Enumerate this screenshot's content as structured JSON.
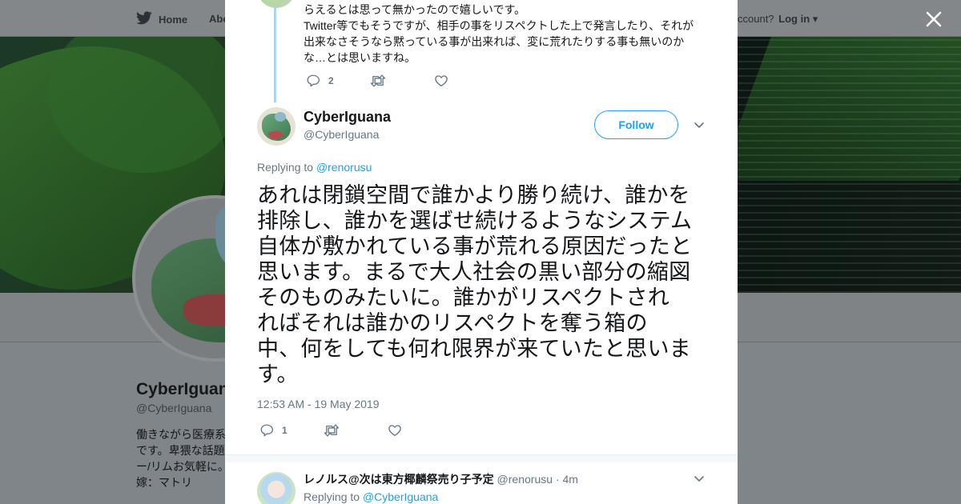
{
  "nav": {
    "home_label": "Home",
    "about_label": "Abo",
    "account_prompt": "ccount?",
    "login_label": "Log in"
  },
  "background_profile": {
    "name": "CyberIguana",
    "handle": "@CyberIguana",
    "bio_lines": [
      "働きながら医療系",
      "です。卑猥な話題",
      "ー/リムお気軽に。",
      "嫁：マトリ"
    ]
  },
  "previous_tweet": {
    "text_lines": [
      "らえるとは思って無かったので嬉しいです。",
      "Twitter等でもそうですが、相手の事をリスペクトした上で発言したり、それが",
      "出来なさそうなら黙っている事が出来れば、変に荒れたりする事も無いのか",
      "な…とは思いますね。"
    ],
    "reply_count": "2",
    "retweet_count": "",
    "like_count": ""
  },
  "main_tweet": {
    "name": "CyberIguana",
    "handle": "@CyberIguana",
    "follow_label": "Follow",
    "replying_prefix": "Replying to",
    "replying_to": "@renorusu",
    "text_lines": [
      "あれは閉鎖空間で誰かより勝り続け、誰かを",
      "排除し、誰かを選ばせ続けるようなシステム",
      "自体が敷かれている事が荒れる原因だったと",
      "思います。まるで大人社会の黒い部分の縮図",
      "そのものみたいに。誰かがリスペクトされ",
      "ればそれは誰かのリスペクトを奪う箱の",
      "中、何をしても何れ限界が来ていたと思いま",
      "す。"
    ],
    "timestamp": "12:53 AM - 19 May 2019",
    "reply_count": "1",
    "retweet_count": "",
    "like_count": ""
  },
  "reply_tweet": {
    "name": "レノルス@次は東方椰麟祭売り子予定",
    "handle": "@renorusu",
    "time": "· 4m",
    "replying_prefix": "Replying to",
    "replying_to": "@CyberIguana"
  },
  "colors": {
    "accent": "#1da1f2",
    "thread_line": "#a8d6f4",
    "muted": "#657786"
  },
  "icons": [
    "twitter-bird-icon",
    "close-icon",
    "reply-icon",
    "retweet-icon",
    "heart-icon",
    "chevron-down-icon"
  ]
}
